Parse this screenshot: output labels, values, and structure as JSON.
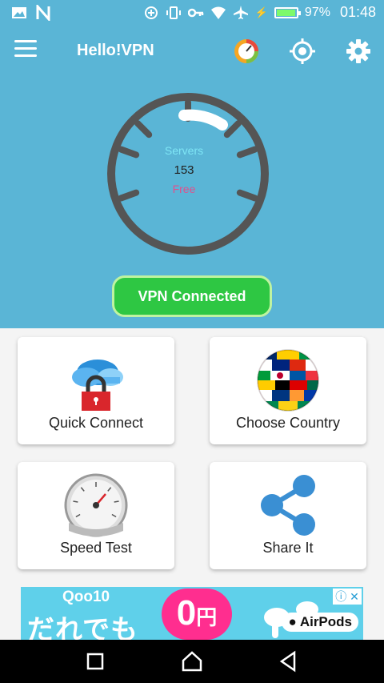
{
  "status_bar": {
    "battery_percent": "97%",
    "battery_level": 0.97,
    "time": "01:48",
    "icons": [
      "image-icon",
      "n-icon",
      "data-saver-icon",
      "vibrate-icon",
      "key-icon",
      "wifi-icon",
      "airplane-icon",
      "battery-icon"
    ]
  },
  "toolbar": {
    "title": "Hello!VPN",
    "icons": [
      "menu-icon",
      "speed-badge-icon",
      "crosshair-icon",
      "gear-icon"
    ]
  },
  "gauge": {
    "servers_label": "Servers",
    "server_count": "153",
    "plan_label": "Free"
  },
  "vpn_button": {
    "label": "VPN Connected"
  },
  "cards": {
    "quick_connect": "Quick Connect",
    "choose_country": "Choose Country",
    "speed_test": "Speed Test",
    "share_it": "Share It"
  },
  "ad": {
    "brand": "Qoo10",
    "headline": "だれでも",
    "zero": "0",
    "yen": "円",
    "product": "AirPods"
  },
  "colors": {
    "header": "#5ab5d6",
    "connected_green": "#2ec743",
    "servers_text": "#7ee5f5",
    "free_text": "#e0508c",
    "ad_pink": "#ff2e8f"
  }
}
